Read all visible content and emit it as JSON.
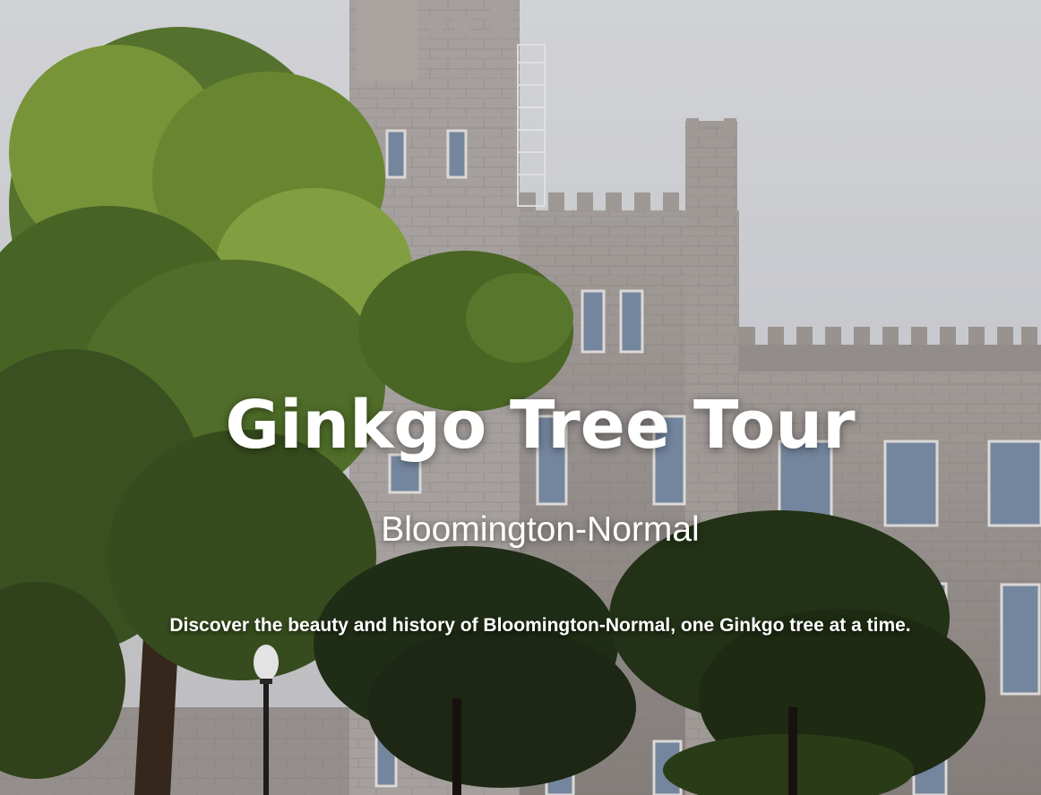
{
  "hero": {
    "title": "Ginkgo Tree Tour",
    "subtitle": "Bloomington-Normal",
    "tagline": "Discover the beauty and history of Bloomington-Normal, one Ginkgo tree at a time."
  },
  "colors": {
    "text": "#ffffff",
    "sky": "#d9dbe0",
    "stone": "#a59f9c",
    "foliage": "#3f5a2a"
  }
}
